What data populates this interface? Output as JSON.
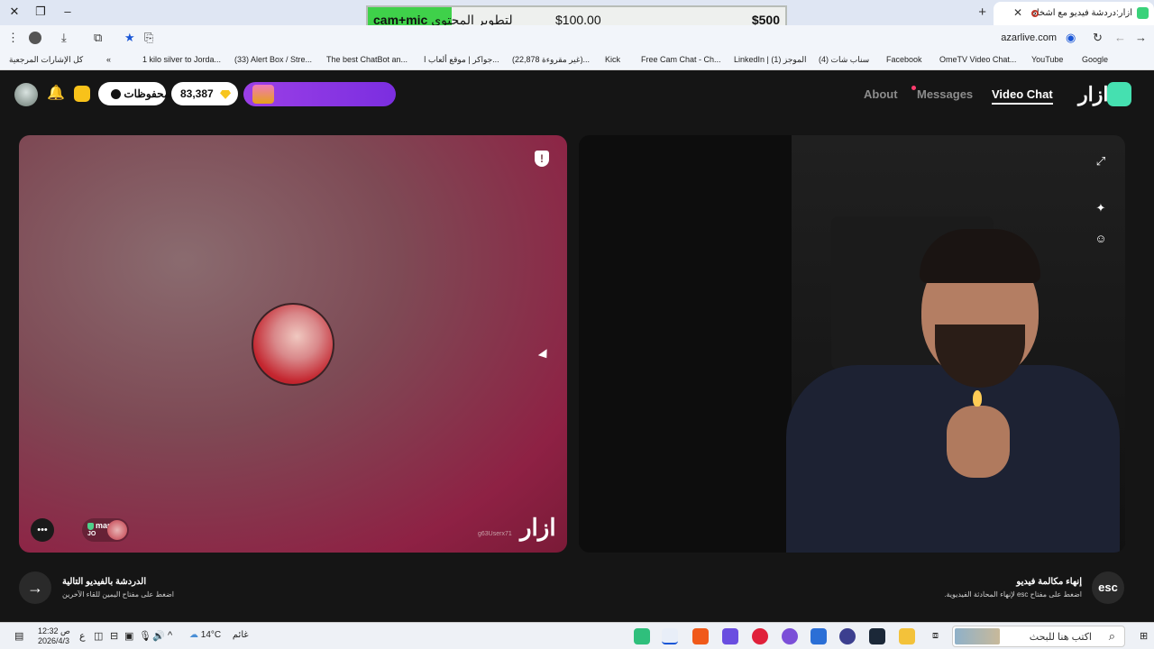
{
  "browser": {
    "tab_title": "أزار:دردشة فيديو مع أشخاص",
    "new_tab_symbol": "+",
    "url": "azarlive.com",
    "goal_widget": {
      "left_label": "cam+mic",
      "left_text": "لتطوير المحتوى",
      "current": "$100.00",
      "target": "$500",
      "progress": 0.2
    },
    "bookmarks": [
      "Google",
      "YouTube",
      "OmeTV Video Chat...",
      "Facebook",
      "(4) سناب شات",
      "LinkedIn | (1) الموجز",
      "Free Cam Chat - Ch...",
      "Kick",
      "(22,878 غير مقروءة)...",
      "جواكر | موقع ألعاب ا...",
      "The best ChatBot an...",
      "(33) Alert Box / Stre...",
      "1 kilo silver to Jorda...",
      "كل الإشارات المرجعية"
    ]
  },
  "header": {
    "saved_label": "المحفوظات",
    "gems_count": "83,387",
    "nav": {
      "about": "About",
      "messages": "Messages",
      "video_chat": "Video Chat"
    },
    "logo_text": "ازار"
  },
  "left_video": {
    "user_name": "marya",
    "user_country": "JO",
    "user_id": "g63Userx71",
    "watermark": "ازار",
    "report_symbol": "!"
  },
  "right_video": {
    "icons": [
      "fullscreen-icon",
      "magic-wand-icon",
      "face-filter-icon"
    ]
  },
  "bottom": {
    "next": {
      "title": "الدردشة بالفيديو التالية",
      "subtitle": "اضغط على مفتاح اليمين للقاء الآخرين"
    },
    "end": {
      "key": "esc",
      "title": "إنهاء مكالمة فيديو",
      "subtitle": "اضغط على مفتاح esc لإنهاء المحادثة الفيديوية."
    }
  },
  "taskbar": {
    "time": "12:32 ص",
    "date": "2026/4/3",
    "lang": "ع",
    "weather_temp": "14°C",
    "weather_desc": "غائم",
    "search_placeholder": "اكتب هنا للبحث"
  },
  "colors": {
    "accent_green": "#45e0b0",
    "promo_purple": "#8a36e6",
    "goal_green": "#3fd14a"
  }
}
